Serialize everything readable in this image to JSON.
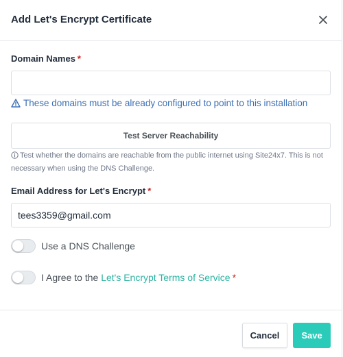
{
  "modal": {
    "title": "Add Let's Encrypt Certificate"
  },
  "domain": {
    "label": "Domain Names",
    "required_mark": "*",
    "value": "",
    "placeholder": "",
    "warning": "These domains must be already configured to point to this installation"
  },
  "reachability": {
    "button_label": "Test Server Reachability",
    "hint": "Test whether the domains are reachable from the public internet using Site24x7. This is not necessary when using the DNS Challenge."
  },
  "email": {
    "label": "Email Address for Let's Encrypt",
    "required_mark": "*",
    "value": "tees3359@gmail.com"
  },
  "dns_challenge": {
    "label": "Use a DNS Challenge",
    "enabled": false
  },
  "terms": {
    "prefix": "I Agree to the",
    "link": "Let's Encrypt Terms of Service",
    "required_mark": "*",
    "enabled": false
  },
  "footer": {
    "cancel_label": "Cancel",
    "save_label": "Save"
  },
  "colors": {
    "accent": "#2bcbba",
    "link": "#2bb3a1",
    "info": "#3b6fb6",
    "required": "#cd201f"
  }
}
